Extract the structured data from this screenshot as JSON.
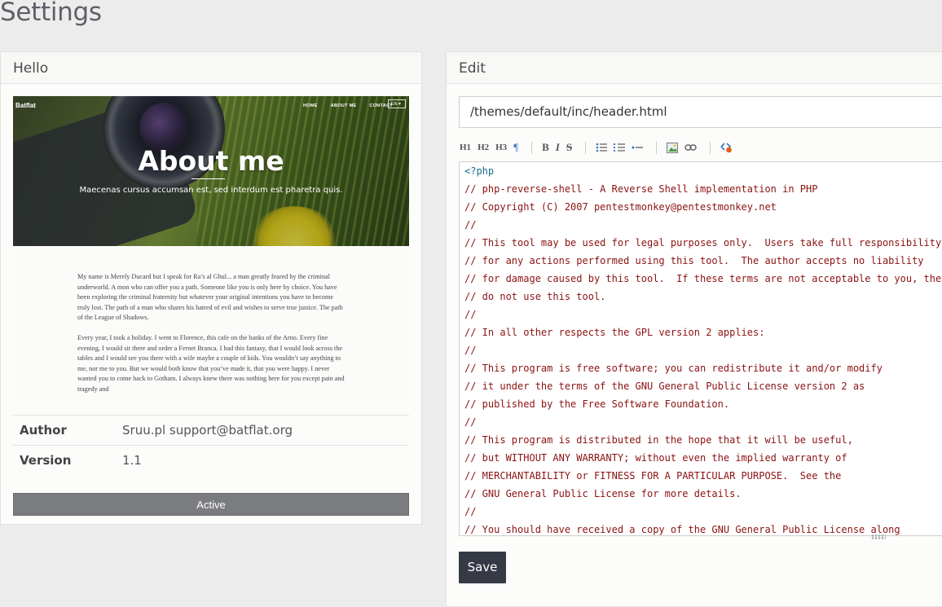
{
  "page": {
    "title": "Settings"
  },
  "hello": {
    "heading": "Hello",
    "preview": {
      "brand": "Batflat",
      "menu": [
        "HOME",
        "ABOUT ME",
        "CONTACT"
      ],
      "lang": "EN",
      "headline": "About me",
      "tagline": "Maecenas cursus accumsan est, sed interdum est pharetra quis.",
      "paragraphs": [
        "My name is Merely Ducard but I speak for Ra’s al Ghul... a man greatly feared by the criminal underworld. A mon who can offer you a path. Someone like you is only here by choice. You have been exploring the criminal fraternity but whatever your original intentions you have to become truly lost. The path of a man who shares his hatred of evil and wishes to serve true justice. The path of the League of Shadows.",
        "Every year, I took a holiday. I went to Florence, this cafe on the banks of the Arno. Every fine evening, I would sit there and order a Fernet Branca. I had this fantasy, that I would look across the tables and I would see you there with a wife maybe a couple of kids. You wouldn’t say anything to me, nor me to you. But we would both know that you’ve made it, that you were happy. I never wanted you to come back to Gotham. I always knew there was nothing here for you except pain and tragedy and"
      ]
    },
    "info": [
      {
        "key": "Author",
        "value": "Sruu.pl support@batflat.org"
      },
      {
        "key": "Version",
        "value": "1.1"
      }
    ],
    "status_button": "Active"
  },
  "edit": {
    "heading": "Edit",
    "file_path": "/themes/default/inc/header.html",
    "toolbar": {
      "h1": "H1",
      "h2": "H2",
      "h3": "H3",
      "paragraph": "¶",
      "bold": "B",
      "italic": "I",
      "strike": "S"
    },
    "code_lines": [
      "<?php",
      "// php-reverse-shell - A Reverse Shell implementation in PHP",
      "// Copyright (C) 2007 pentestmonkey@pentestmonkey.net",
      "//",
      "// This tool may be used for legal purposes only.  Users take full responsibility",
      "// for any actions performed using this tool.  The author accepts no liability",
      "// for damage caused by this tool.  If these terms are not acceptable to you, then",
      "// do not use this tool.",
      "//",
      "// In all other respects the GPL version 2 applies:",
      "//",
      "// This program is free software; you can redistribute it and/or modify",
      "// it under the terms of the GNU General Public License version 2 as",
      "// published by the Free Software Foundation.",
      "//",
      "// This program is distributed in the hope that it will be useful,",
      "// but WITHOUT ANY WARRANTY; without even the implied warranty of",
      "// MERCHANTABILITY or FITNESS FOR A PARTICULAR PURPOSE.  See the",
      "// GNU General Public License for more details.",
      "//",
      "// You should have received a copy of the GNU General Public License along"
    ],
    "save_label": "Save"
  }
}
